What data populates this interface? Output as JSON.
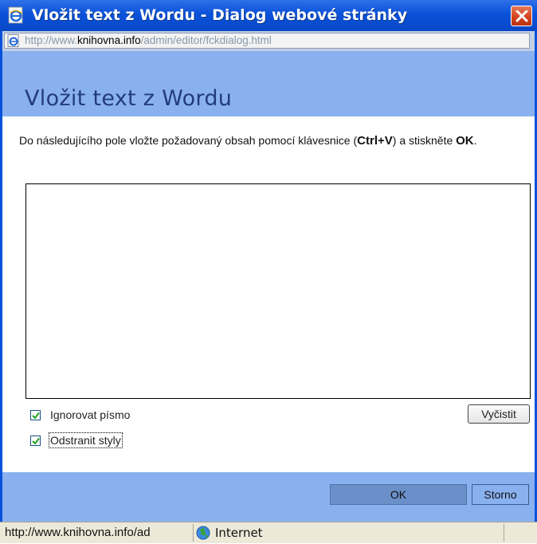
{
  "window": {
    "title": "Vložit text z Wordu - Dialog webové stránky",
    "url_prefix": "http://www.",
    "url_domain": "knihovna.info",
    "url_path": "/admin/editor/fckdialog.html"
  },
  "dialog": {
    "heading": "Vložit text z Wordu",
    "instruction_start": "Do následujícího pole vložte požadovaný obsah pomocí klávesnice (",
    "shortcut": "Ctrl+V",
    "instruction_mid": ") a stiskněte ",
    "ok_emphasis": "OK",
    "instruction_end": ".",
    "paste_area_value": "",
    "options": [
      {
        "label": "Ignorovat písmo",
        "checked": true
      },
      {
        "label": "Odstranit styly",
        "checked": true
      }
    ],
    "clear_button": "Vyčistit",
    "ok_button": "OK",
    "cancel_button": "Storno"
  },
  "statusbar": {
    "url": "http://www.knihovna.info/ad",
    "zone": "Internet"
  },
  "colors": {
    "titlebar": "#0a52d9",
    "panel": "#8ab1ef",
    "heading_text": "#233c7c"
  },
  "icons": {
    "title": "ie-page-icon",
    "address": "ie-page-icon",
    "close": "close-x-icon",
    "zone": "globe-icon",
    "checkbox": "check-icon"
  }
}
